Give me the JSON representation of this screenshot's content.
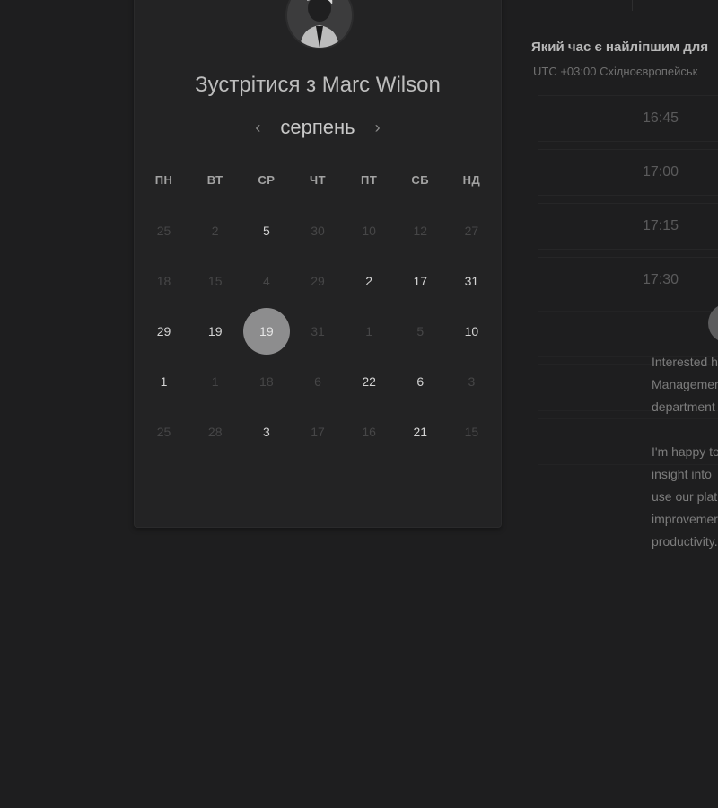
{
  "header": {
    "title": "Зустрітися з Marc Wilson"
  },
  "calendar": {
    "month": "серпень",
    "prev_icon": "chevron-left-icon",
    "next_icon": "chevron-right-icon",
    "weekdays": [
      "ПН",
      "ВТ",
      "СР",
      "ЧТ",
      "ПТ",
      "СБ",
      "НД"
    ],
    "weeks": [
      [
        {
          "d": "25",
          "on": false
        },
        {
          "d": "2",
          "on": false
        },
        {
          "d": "5",
          "on": true
        },
        {
          "d": "30",
          "on": false
        },
        {
          "d": "10",
          "on": false
        },
        {
          "d": "12",
          "on": false
        },
        {
          "d": "27",
          "on": false
        }
      ],
      [
        {
          "d": "18",
          "on": false
        },
        {
          "d": "15",
          "on": false
        },
        {
          "d": "4",
          "on": false
        },
        {
          "d": "29",
          "on": false
        },
        {
          "d": "2",
          "on": true
        },
        {
          "d": "17",
          "on": true
        },
        {
          "d": "31",
          "on": true
        }
      ],
      [
        {
          "d": "29",
          "on": true
        },
        {
          "d": "19",
          "on": true
        },
        {
          "d": "19",
          "on": true,
          "selected": true
        },
        {
          "d": "31",
          "on": false
        },
        {
          "d": "1",
          "on": false
        },
        {
          "d": "5",
          "on": false
        },
        {
          "d": "10",
          "on": true
        }
      ],
      [
        {
          "d": "1",
          "on": true
        },
        {
          "d": "1",
          "on": false
        },
        {
          "d": "18",
          "on": false
        },
        {
          "d": "6",
          "on": false
        },
        {
          "d": "22",
          "on": true
        },
        {
          "d": "6",
          "on": true
        },
        {
          "d": "3",
          "on": false
        }
      ],
      [
        {
          "d": "25",
          "on": false
        },
        {
          "d": "28",
          "on": false
        },
        {
          "d": "3",
          "on": true
        },
        {
          "d": "17",
          "on": false
        },
        {
          "d": "16",
          "on": false
        },
        {
          "d": "21",
          "on": true
        },
        {
          "d": "15",
          "on": false
        }
      ]
    ]
  },
  "times": {
    "question": "Який час є найліпшим для",
    "timezone": "UTC +03:00 Східноєвропейськ",
    "slots": [
      "16:45",
      "17:00",
      "17:15",
      "17:30"
    ]
  },
  "note": {
    "p1": "Interested h\nManagemer\ndepartment",
    "p2": "I'm happy to\ninsight into\nuse our plat\nimprovemer\nproductivity."
  },
  "colors": {
    "background": "#1e1e1f",
    "card": "#232324",
    "selected_day": "#8d8d8e"
  }
}
